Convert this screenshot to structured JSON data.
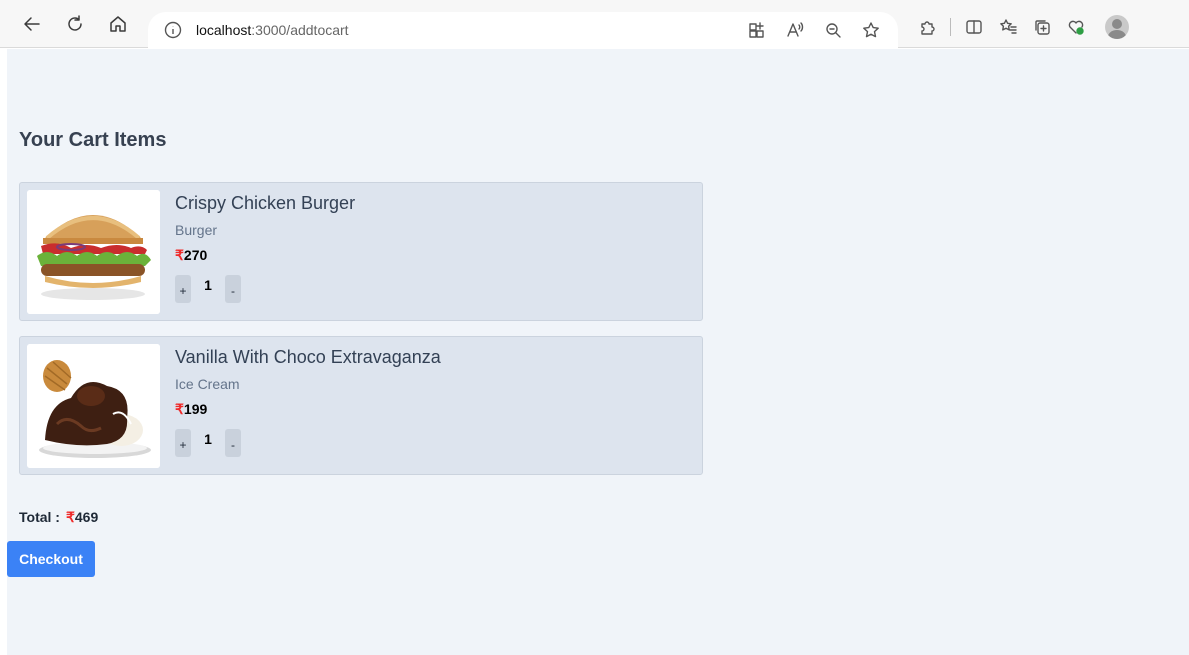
{
  "browser": {
    "url_host": "localhost",
    "url_rest": ":3000/addtocart",
    "icons": [
      "back-icon",
      "refresh-icon",
      "home-icon",
      "info-icon",
      "app-available-icon",
      "read-aloud-icon",
      "zoom-out-icon",
      "favorite-star-icon",
      "extensions-icon",
      "split-screen-icon",
      "favorites-icon",
      "collections-icon",
      "browser-essentials-icon",
      "profile-avatar"
    ]
  },
  "page": {
    "heading": "Your Cart Items",
    "items": [
      {
        "name": "Crispy Chicken Burger",
        "category": "Burger",
        "currency": "₹",
        "price": "270",
        "qty": "1",
        "plus": "+",
        "minus": "-"
      },
      {
        "name": "Vanilla With Choco Extravaganza",
        "category": "Ice Cream",
        "currency": "₹",
        "price": "199",
        "qty": "1",
        "plus": "+",
        "minus": "-"
      }
    ],
    "total_label": "Total :",
    "total_currency": "₹",
    "total_amount": "469",
    "checkout_label": "Checkout"
  },
  "colors": {
    "page_bg": "#f0f4f9",
    "card_bg": "#dde4ee",
    "accent": "#3b82f6",
    "rupee": "#ef2b2b"
  }
}
